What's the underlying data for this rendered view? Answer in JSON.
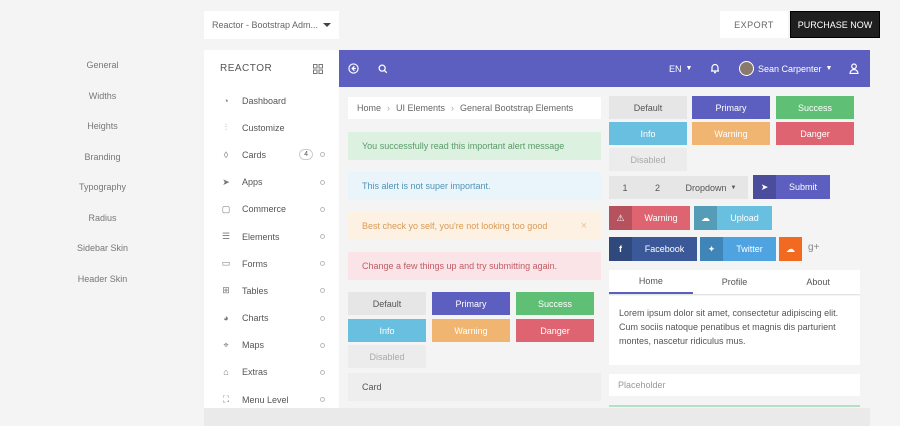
{
  "topbar": {
    "select_value": "Reactor - Bootstrap Adm...",
    "export_label": "EXPORT",
    "purchase_label": "PURCHASE NOW"
  },
  "options": [
    "General",
    "Widths",
    "Heights",
    "Branding",
    "Typography",
    "Radius",
    "Sidebar Skin",
    "Header Skin"
  ],
  "sidebar": {
    "brand": "REACTOR",
    "items": [
      {
        "label": "Dashboard",
        "icon": "dashboard-icon"
      },
      {
        "label": "Customize",
        "icon": "sliders-icon"
      },
      {
        "label": "Cards",
        "icon": "drop-icon",
        "badge": "4"
      },
      {
        "label": "Apps",
        "icon": "send-icon"
      },
      {
        "label": "Commerce",
        "icon": "bag-icon"
      },
      {
        "label": "Elements",
        "icon": "list-icon"
      },
      {
        "label": "Forms",
        "icon": "form-icon"
      },
      {
        "label": "Tables",
        "icon": "table-icon"
      },
      {
        "label": "Charts",
        "icon": "pie-icon"
      },
      {
        "label": "Maps",
        "icon": "map-pin-icon"
      },
      {
        "label": "Extras",
        "icon": "tag-icon"
      },
      {
        "label": "Menu Level",
        "icon": "expand-icon"
      }
    ]
  },
  "header": {
    "lang": "EN",
    "user": "Sean Carpenter"
  },
  "breadcrumb": [
    "Home",
    "UI Elements",
    "General Bootstrap Elements"
  ],
  "alerts": [
    {
      "text": "You successfully read this important alert message",
      "bg": "#dcf1e0",
      "color": "#5a9a69"
    },
    {
      "text": "This alert is not super important.",
      "bg": "#eaf5fb",
      "color": "#4f93b6"
    },
    {
      "text": "Best check yo self, you're not looking too good",
      "bg": "#fdf1e4",
      "color": "#d99a55",
      "close": "×"
    },
    {
      "text": "Change a few things up and try submitting again.",
      "bg": "#fbe4e7",
      "color": "#c25a66"
    }
  ],
  "buttons": {
    "default": "Default",
    "primary": "Primary",
    "success": "Success",
    "info": "Info",
    "warning": "Warning",
    "danger": "Danger",
    "disabled": "Disabled"
  },
  "card_label": "Card",
  "group": {
    "one": "1",
    "two": "2",
    "dropdown": "Dropdown",
    "submit": "Submit"
  },
  "icon_buttons": {
    "warning": "Warning",
    "upload": "Upload",
    "facebook": "Facebook",
    "twitter": "Twitter"
  },
  "tabs": [
    "Home",
    "Profile",
    "About"
  ],
  "tab_text": "Lorem ipsum dolor sit amet, consectetur adipiscing elit. Cum sociis natoque penatibus et magnis dis parturient montes, nascetur ridiculus mus.",
  "placeholder": "Placeholder",
  "colors": {
    "primary": "#5c5fbf",
    "success": "#5fbf75",
    "info": "#68bfe0",
    "warning": "#f0b571",
    "danger": "#de6472",
    "facebook": "#3b5998",
    "twitter": "#4fa3e0",
    "soundcloud": "#f26a21"
  }
}
